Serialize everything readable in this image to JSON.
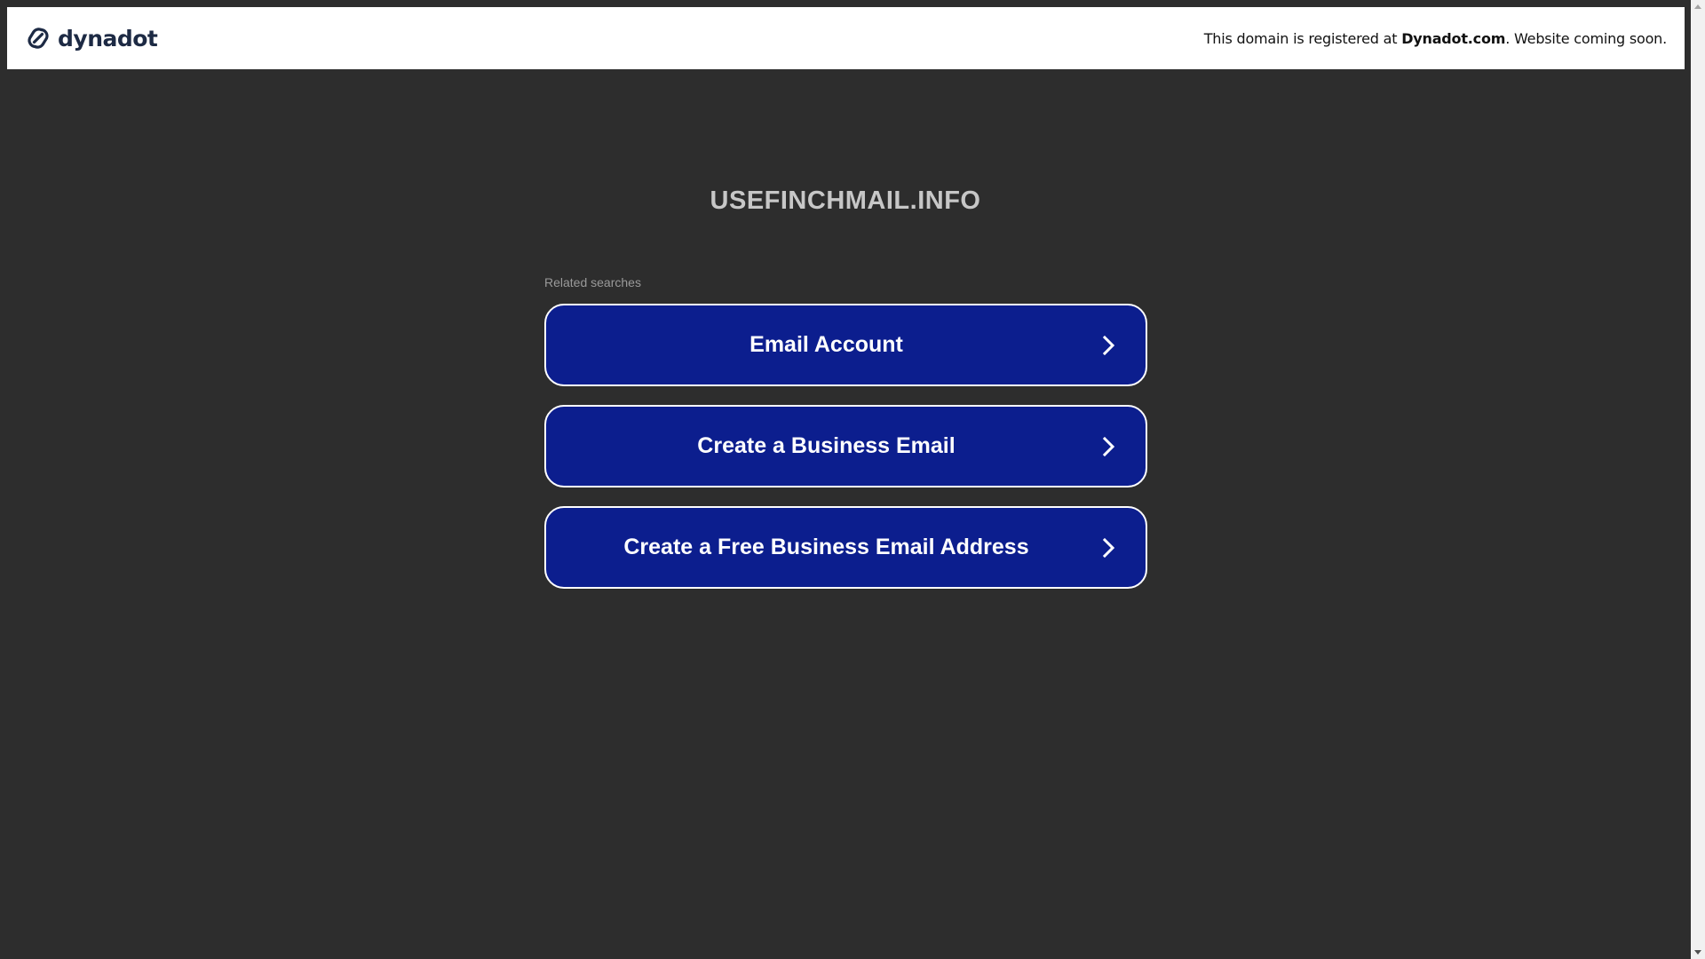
{
  "banner": {
    "logo_text": "dynadot",
    "message_prefix": "This domain is registered at ",
    "message_brand": "Dynadot.com",
    "message_suffix": ". Website coming soon."
  },
  "domain": {
    "title": "USEFINCHMAIL.INFO"
  },
  "related": {
    "label": "Related searches",
    "items": [
      {
        "label": "Email Account"
      },
      {
        "label": "Create a Business Email"
      },
      {
        "label": "Create a Free Business Email Address"
      }
    ]
  },
  "colors": {
    "background": "#2d2d2d",
    "button_fill": "#0c1e8e",
    "button_border": "#ffffff",
    "banner_bg": "#ffffff",
    "logo": "#1d2a44",
    "title": "#c7c7c7"
  },
  "icons": {
    "logo": "dynadot-logo-icon",
    "chevron": "chevron-right-icon"
  }
}
